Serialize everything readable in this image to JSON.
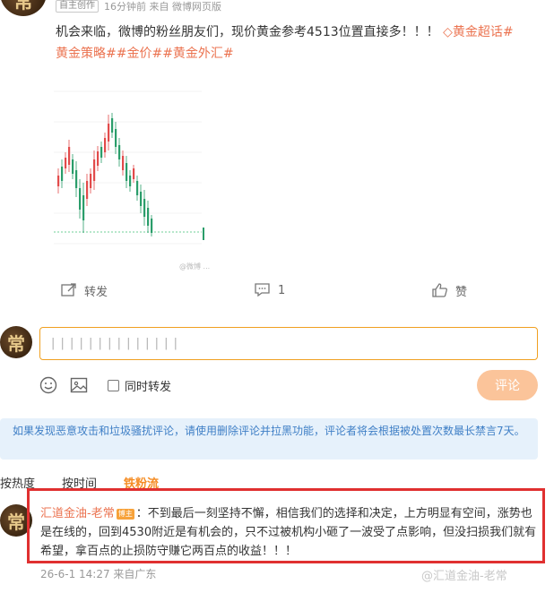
{
  "post": {
    "badge": "自主创作",
    "meta": "16分钟前  来自 微博网页版",
    "text": "机会来临，微博的粉丝朋友们，现价黄金参考4513位置直接多！！！",
    "topics": [
      "黄金超话#",
      "黄金策略##金价##黄金外汇#"
    ],
    "chart_watermark": "@微博 ..."
  },
  "actions": {
    "forward_label": "转发",
    "comment_count": "1",
    "like_label": "赞"
  },
  "composer": {
    "input_value": "| | | | | | | | | | | | | |",
    "repost_label": "同时转发",
    "submit_label": "评论"
  },
  "notice": "如果发现恶意攻击和垃圾骚扰评论，请使用删除评论并拉黑功能，评论者将会根据被处置次数最长禁言7天。",
  "sort": {
    "hot": "按热度",
    "time": "按时间",
    "fans": "铁粉流"
  },
  "comment": {
    "user": "汇道金油-老常",
    "badge": "博主",
    "text": "：不到最后一刻坚持不懈，相信我们的选择和决定，上方明显有空间，涨势也是在线的，回到4530附近是有机会的，只不过被机构小砸了一波受了点影响，但没扫损我们就有希望，拿百点的止损防守赚它两百点的收益！！！",
    "time": "26-6-1 14:27  来自广东",
    "watermark": "@汇道金油-老常"
  },
  "avatar_glyph": "常",
  "colors": {
    "accent_orange": "#eb7350",
    "candle_up": "#e24b4b",
    "candle_down": "#2a9d6a",
    "highlight_red": "#e03030"
  }
}
